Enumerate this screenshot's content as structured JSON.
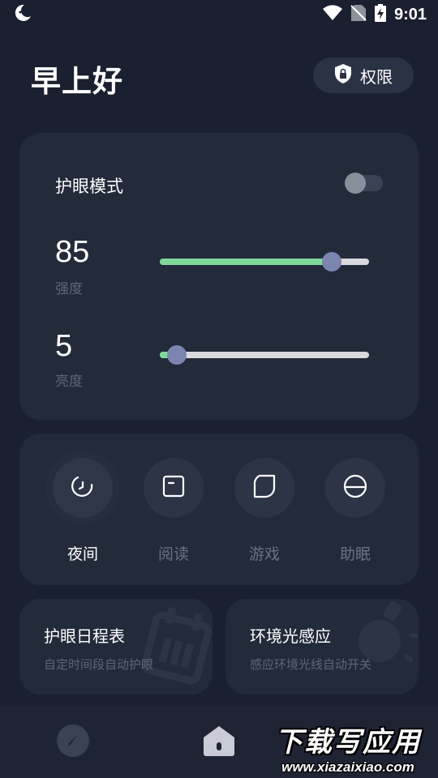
{
  "status_bar": {
    "time": "9:01",
    "icons": [
      "moon-icon",
      "wifi-icon",
      "no-sim-icon",
      "battery-charging-icon"
    ]
  },
  "header": {
    "greeting": "早上好",
    "permission_button": "权限",
    "permission_icon": "shield-lock-icon"
  },
  "eye_care": {
    "title": "护眼模式",
    "enabled": false,
    "intensity": {
      "value": "85",
      "label": "强度",
      "level": 0.82
    },
    "brightness": {
      "value": "5",
      "label": "亮度",
      "level": 0.08
    }
  },
  "modes": [
    {
      "label": "夜间",
      "icon": "night-clock-icon",
      "active": true
    },
    {
      "label": "阅读",
      "icon": "book-icon",
      "active": false
    },
    {
      "label": "游戏",
      "icon": "game-icon",
      "active": false
    },
    {
      "label": "助眠",
      "icon": "sleep-icon",
      "active": false
    }
  ],
  "schedule_card": {
    "title": "护眼日程表",
    "subtitle": "自定时间段自动护眼",
    "icon": "calendar-icon"
  },
  "ambient_card": {
    "title": "环境光感应",
    "subtitle": "感应环境光线自动开关",
    "icon": "light-sensor-icon"
  },
  "bottom_nav": {
    "items": [
      "compass-icon",
      "home-icon"
    ],
    "active": "home-icon"
  },
  "watermark": {
    "title": "下载写应用",
    "url": "www.xiazaixiao.com"
  },
  "colors": {
    "background": "#1b2030",
    "card": "#232a3a",
    "accent_green": "#7ed89a",
    "thumb": "#7c84b0",
    "muted_text": "#5e6678"
  }
}
